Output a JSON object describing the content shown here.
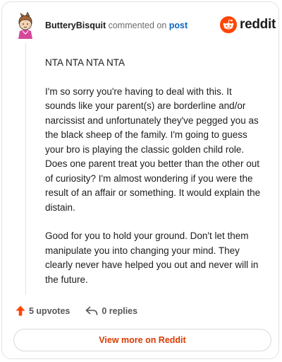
{
  "comment": {
    "author": "ButteryBisquit",
    "action_text": "commented on",
    "post_link": "post",
    "paragraphs": [
      "NTA NTA NTA NTA",
      "I'm so sorry you're having to deal with this. It sounds like your parent(s) are borderline and/or narcissist and unfortunately they've pegged you as the black sheep of the family. I'm going to guess your bro is playing the classic golden child role. Does one parent treat you better than the other out of curiosity? I'm almost wondering if you were the result of an affair or something. It would explain the distain.",
      "Good for you to hold your ground. Don't let them manipulate you into changing your mind. They clearly never have helped you out and never will in the future."
    ]
  },
  "brand": {
    "wordmark": "reddit",
    "color": "#ff4500"
  },
  "actions": {
    "upvotes": "5 upvotes",
    "replies": "0 replies",
    "upvote_icon": "upvote-arrow-icon",
    "reply_icon": "reply-arrow-icon"
  },
  "footer": {
    "view_more_label": "View more on Reddit",
    "accent": "#d93a00"
  }
}
